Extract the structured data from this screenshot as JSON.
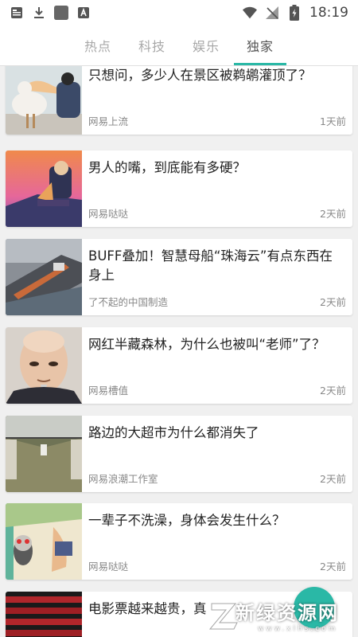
{
  "status_bar": {
    "time": "18:19"
  },
  "tabs": [
    {
      "label": "热点",
      "active": false
    },
    {
      "label": "科技",
      "active": false
    },
    {
      "label": "娱乐",
      "active": false
    },
    {
      "label": "独家",
      "active": true
    }
  ],
  "articles": [
    {
      "title": "只想问，多少人在景区被鹈鹕灌顶了？",
      "source": "网易上流",
      "time": "1天前"
    },
    {
      "title": "男人的嘴，到底能有多硬？",
      "source": "网易哒哒",
      "time": "2天前"
    },
    {
      "title": "BUFF叠加！智慧母船“珠海云”有点东西在身上",
      "source": "了不起的中国制造",
      "time": "2天前"
    },
    {
      "title": "网红半藏森林，为什么也被叫“老师”了？",
      "source": "网易槽值",
      "time": "2天前"
    },
    {
      "title": "路边的大超市为什么都消失了",
      "source": "网易浪潮工作室",
      "time": "2天前"
    },
    {
      "title": "一辈子不洗澡，身体会发生什么？",
      "source": "网易哒哒",
      "time": "2天前"
    },
    {
      "title": "电影票越来越贵，真",
      "source": "",
      "time": ""
    }
  ],
  "watermark": {
    "text": "新绿资源网",
    "sub": "www.xlhs.com"
  },
  "colors": {
    "accent": "#2ab8a6"
  }
}
